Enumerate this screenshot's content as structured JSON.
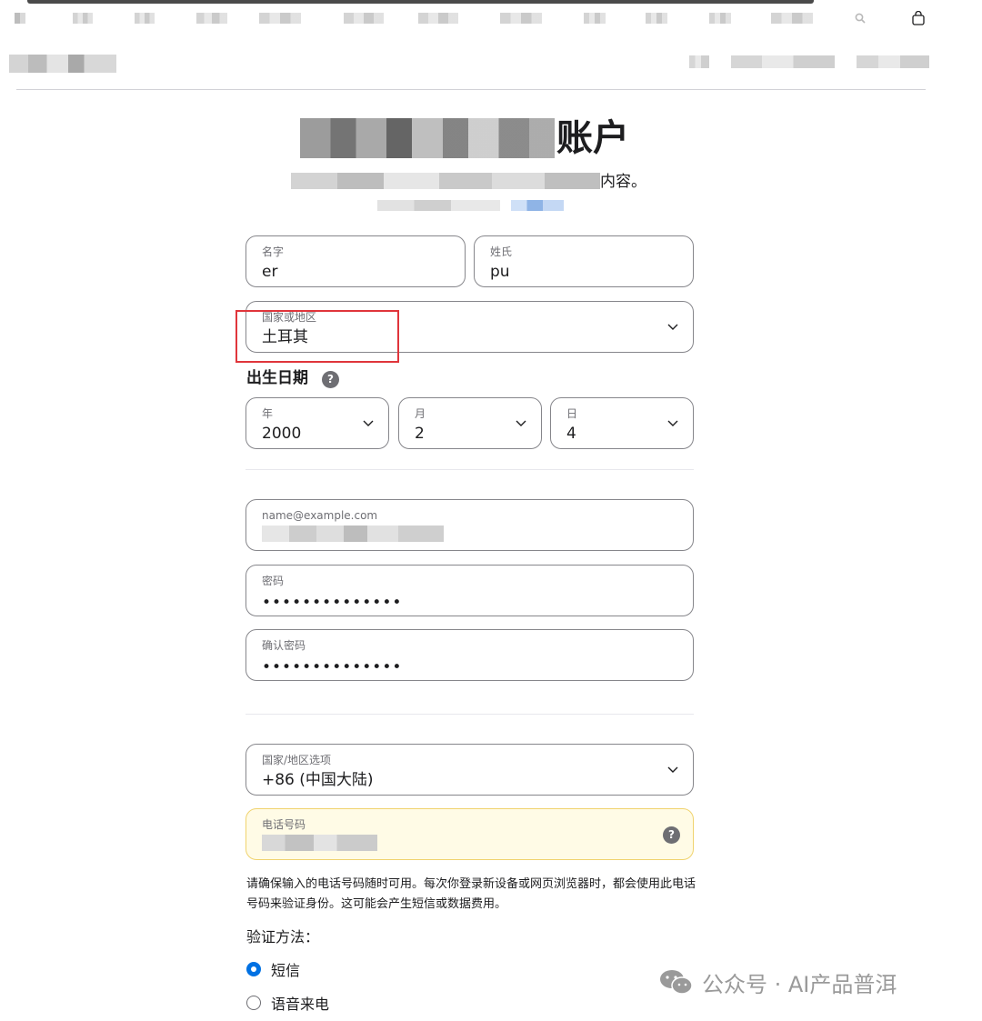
{
  "header": {
    "title_visible_tail": "账户",
    "subtitle_visible_tail": "内容。"
  },
  "form": {
    "first_name": {
      "label": "名字",
      "value": "er"
    },
    "last_name": {
      "label": "姓氏",
      "value": "pu"
    },
    "country": {
      "label": "国家或地区",
      "value": "土耳其"
    },
    "dob": {
      "heading": "出生日期",
      "help": "?",
      "year": {
        "label": "年",
        "value": "2000"
      },
      "month": {
        "label": "月",
        "value": "2"
      },
      "day": {
        "label": "日",
        "value": "4"
      }
    },
    "email": {
      "label": "name@example.com"
    },
    "password": {
      "label": "密码",
      "value": "••••••••••••••"
    },
    "confirm_password": {
      "label": "确认密码",
      "value": "••••••••••••••"
    },
    "phone_country": {
      "label": "国家/地区选项",
      "value": "+86 (中国大陆)"
    },
    "phone": {
      "label": "电话号码",
      "help": "?"
    },
    "phone_note": "请确保输入的电话号码随时可用。每次你登录新设备或网页浏览器时，都会使用此电话号码来验证身份。这可能会产生短信或数据费用。",
    "verify": {
      "heading": "验证方法：",
      "options": [
        {
          "label": "短信",
          "selected": true
        },
        {
          "label": "语音来电",
          "selected": false
        }
      ]
    }
  },
  "watermark": {
    "text": "公众号 · AI产品普洱"
  },
  "colors": {
    "accent": "#0071e3",
    "highlight_box": "#e0353b",
    "phone_field_bg": "#fffbe6"
  }
}
